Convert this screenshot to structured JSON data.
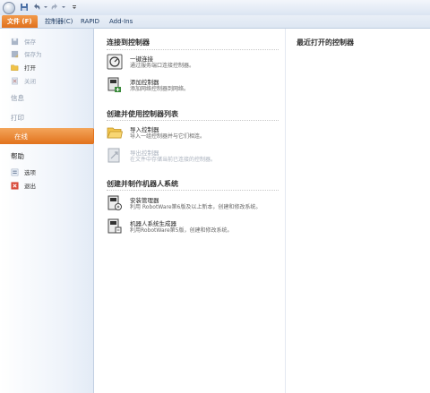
{
  "tabs": {
    "file": "文件 (F)",
    "controller": "控制器(C)",
    "rapid": "RAPID",
    "addins": "Add-Ins"
  },
  "leftnav": {
    "save": "保存",
    "save_as": "保存为",
    "open": "打开",
    "close": "关闭",
    "info": "信息",
    "print": "打印",
    "online": "在线",
    "help": "帮助",
    "options": "选项",
    "exit": "退出"
  },
  "main": {
    "connect_title": "连接到控制器",
    "one_click_title": "一键连接",
    "one_click_desc": "通过服务端口连接控制器。",
    "add_controller_title": "添加控制器",
    "add_controller_desc": "添加网络控制器到网络。",
    "list_title": "创建并使用控制器列表",
    "import_title": "导入控制器",
    "import_desc": "导入一组控制器并与它们相连。",
    "export_title": "导出控制器",
    "export_desc": "在文件中存储当前已连接的控制器。",
    "robot_title": "创建并制作机器人系统",
    "installer_title": "安装管理器",
    "installer_desc": "利用 RobotWare第6版及以上新本，创建和修改系统。",
    "builder_title": "机器人系统生成器",
    "builder_desc": "利用RobotWare第5版，创建和修改系统。"
  },
  "recent": {
    "title": "最近打开的控制器"
  },
  "colors": {
    "accent_orange": "#e2721c",
    "ribbon_blue": "#dde6f2"
  }
}
